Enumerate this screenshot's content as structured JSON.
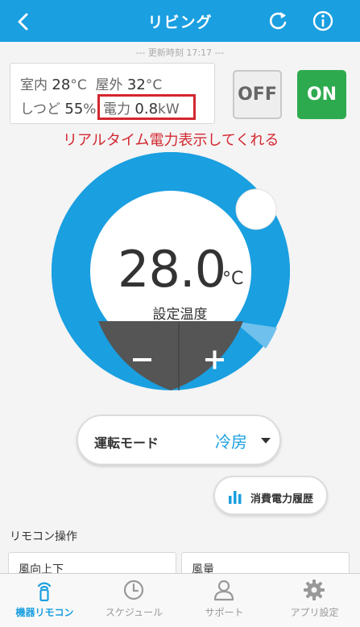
{
  "header": {
    "title": "リビング"
  },
  "updated": "--- 更新時刻 17:17 ---",
  "status": {
    "indoor_label": "室内",
    "indoor_value": "28",
    "indoor_unit": "°C",
    "outdoor_label": "屋外",
    "outdoor_value": "32",
    "outdoor_unit": "°C",
    "humidity_label": "しつど",
    "humidity_value": "55",
    "humidity_unit": "%",
    "power_label": "電力",
    "power_value": "0.8",
    "power_unit": "kW"
  },
  "buttons": {
    "off": "OFF",
    "on": "ON"
  },
  "annotation": "リアルタイム電力表示してくれる",
  "temperature": {
    "value": "28.0",
    "unit": "°C",
    "label": "設定温度",
    "dial_fraction": 0.58
  },
  "mode": {
    "label": "運転モード",
    "value": "冷房"
  },
  "history_button": "消費電力履歴",
  "remote_section": {
    "title": "リモコン操作",
    "panels": [
      {
        "label": "風向上下"
      },
      {
        "label": "風量"
      }
    ]
  },
  "tabs": [
    {
      "label": "機器リモコン",
      "icon": "remote-icon",
      "active": true
    },
    {
      "label": "スケジュール",
      "icon": "clock-icon",
      "active": false
    },
    {
      "label": "サポート",
      "icon": "person-icon",
      "active": false
    },
    {
      "label": "アプリ設定",
      "icon": "gear-icon",
      "active": false
    }
  ],
  "colors": {
    "accent": "#1a9fe0",
    "on": "#2eaa4e",
    "annotation": "#d3272f"
  }
}
